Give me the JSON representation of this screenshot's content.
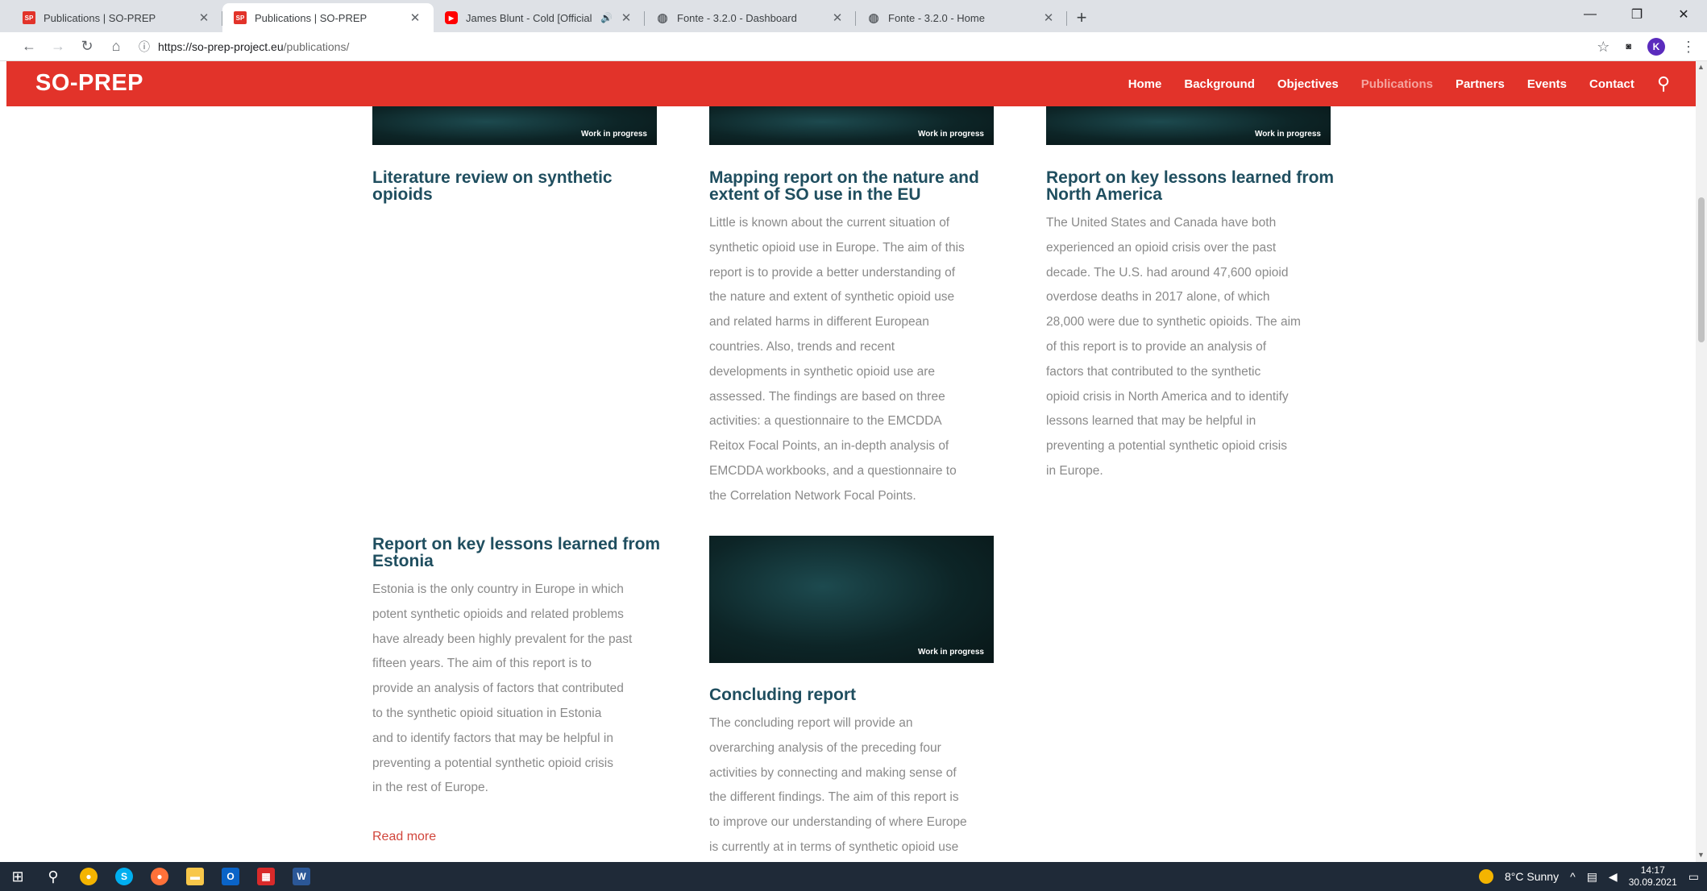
{
  "browser": {
    "tabs": [
      {
        "title": "Publications | SO-PREP",
        "favicon": "so-prep-favicon",
        "active": false
      },
      {
        "title": "Publications | SO-PREP",
        "favicon": "so-prep-favicon",
        "active": true
      },
      {
        "title": "James Blunt - Cold [Official",
        "favicon": "youtube-icon",
        "active": false,
        "audio": true
      },
      {
        "title": "Fonte - 3.2.0 - Dashboard",
        "favicon": "globe-icon",
        "active": false
      },
      {
        "title": "Fonte - 3.2.0 - Home",
        "favicon": "globe-icon",
        "active": false
      }
    ],
    "url_host": "https://so-prep-project.eu",
    "url_path": "/publications/",
    "profile_initial": "K"
  },
  "site": {
    "logo": "SO-PREP",
    "nav": [
      "Home",
      "Background",
      "Objectives",
      "Publications",
      "Partners",
      "Events",
      "Contact"
    ],
    "current": "Publications"
  },
  "cards": {
    "wip_label": "Work in progress",
    "lit_review": {
      "title_line1": "Literature review on synthetic",
      "title_line2": "opioids"
    },
    "mapping": {
      "title_line1": "Mapping report on the nature and",
      "title_line2": "extent of SO use in the EU",
      "lines": [
        "Little is known about the current situation of",
        "synthetic opioid use in Europe. The aim of this",
        "report is to provide a better understanding of",
        "the nature and extent of synthetic opioid use",
        "and related harms in different European",
        "countries. Also, trends and recent",
        "developments in synthetic opioid use are",
        "assessed. The findings are based on three",
        "activities: a questionnaire to the EMCDDA",
        "Reitox Focal Points, an in-depth analysis of",
        "EMCDDA workbooks, and a questionnaire to",
        "the Correlation Network Focal Points."
      ]
    },
    "north_america": {
      "title_line1": "Report on key lessons learned from",
      "title_line2": "North America",
      "lines": [
        "The United States and Canada have both",
        "experienced an opioid crisis over the past",
        "decade. The U.S. had around 47,600 opioid",
        "overdose deaths in 2017 alone, of which",
        "28,000 were due to synthetic opioids. The aim",
        "of this report is to provide an analysis of",
        "factors that contributed to the synthetic",
        "opioid crisis in North America and to identify",
        "lessons learned that may be helpful in",
        "preventing a potential synthetic opioid crisis",
        "in Europe."
      ]
    },
    "estonia": {
      "title_line1": "Report on key lessons learned from",
      "title_line2": "Estonia",
      "lines": [
        "Estonia is the only country in Europe in which",
        "potent synthetic opioids and related problems",
        "have already been highly prevalent for the past",
        "fifteen years. The aim of this report is to",
        "provide an analysis of factors that contributed",
        "to the synthetic opioid situation in Estonia",
        "and to identify factors that may be helpful in",
        "preventing a potential synthetic opioid crisis",
        "in the rest of Europe."
      ],
      "read_more": "Read more"
    },
    "concluding": {
      "title": "Concluding report",
      "lines": [
        "The concluding report will provide an",
        "overarching analysis of the preceding four",
        "activities by connecting and making sense of",
        "the different findings. The aim of this report is",
        "to improve our understanding of where Europe",
        "is currently at in terms of synthetic opioid use"
      ]
    }
  },
  "taskbar": {
    "weather": "8°C  Sunny",
    "time": "14:17",
    "date": "30.09.2021"
  }
}
